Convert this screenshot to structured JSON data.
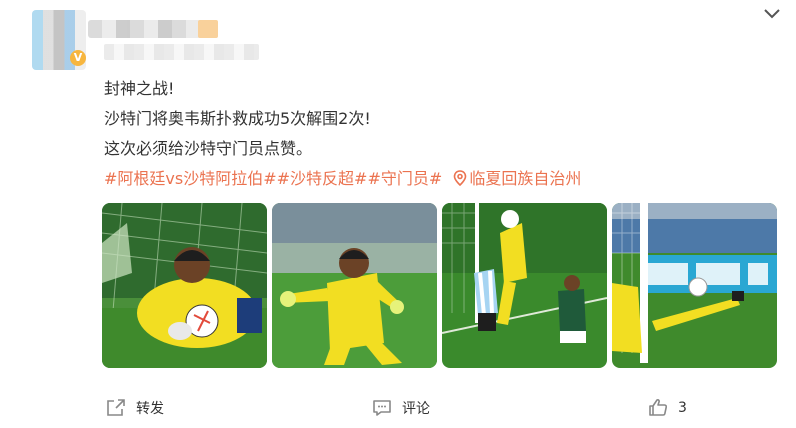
{
  "post": {
    "lines": [
      "封神之战!",
      "沙特门将奥韦斯扑救成功5次解围2次!",
      "这次必须给沙特守门员点赞。"
    ],
    "tags": [
      "#阿根廷vs沙特阿拉伯#",
      "#沙特反超#",
      "#守门员#"
    ],
    "location": "临夏回族自治州",
    "images": [
      {
        "icon": "goalkeeper-save-photo"
      },
      {
        "icon": "goalkeeper-celebration-photo"
      },
      {
        "icon": "goalkeeper-catch-photo"
      },
      {
        "icon": "goalkeeper-dive-photo"
      }
    ]
  },
  "actions": {
    "repost_label": "转发",
    "comment_label": "评论",
    "like_count": "3"
  },
  "colors": {
    "accent": "#eb7350",
    "text": "#333333",
    "icon": "#888888",
    "keeper_yellow": "#f2de22",
    "pitch_green": "#3f8a2c"
  }
}
